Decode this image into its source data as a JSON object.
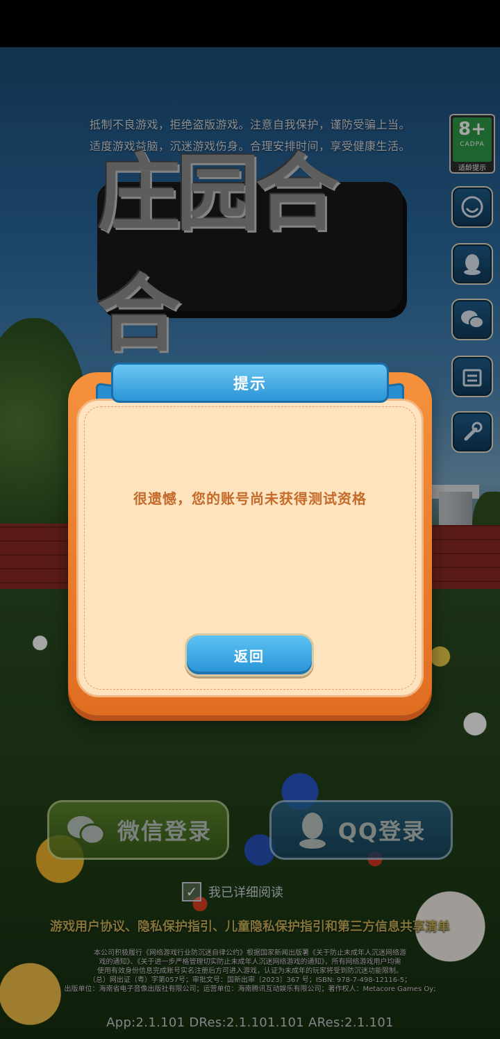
{
  "notice": {
    "line1": "抵制不良游戏，拒绝盗版游戏。注意自我保护，谨防受骗上当。",
    "line2": "适度游戏益脑，沉迷游戏伤身。合理安排时间，享受健康生活。"
  },
  "logo": {
    "text": "庄园合合"
  },
  "age_rating": {
    "value": "8+",
    "org": "CADPA",
    "label": "适龄提示"
  },
  "dialog": {
    "title": "提示",
    "message": "很遗憾，您的账号尚未获得测试资格",
    "return_label": "返回"
  },
  "login": {
    "wechat_label": "微信登录",
    "qq_label": "QQ登录"
  },
  "agreement": {
    "read_label": "我已详细阅读",
    "checked": true,
    "link_user": "游戏用户协议",
    "sep1": "、",
    "link_privacy": "隐私保护指引",
    "sep2": "、",
    "link_child": "儿童隐私保护指引",
    "sep3": "和",
    "link_third": "第三方信息共享清单"
  },
  "legal": {
    "line1": "本公司积极履行《网络游戏行业防沉迷自律公约》根据国家新闻出版署《关于防止未成年人沉迷网络游",
    "line2": "戏的通知》、《关于进一步严格管理切实防止未成年人沉迷网络游戏的通知》，所有网络游戏用户均需",
    "line3": "使用有效身份信息完成账号实名注册后方可进入游戏，认证为未成年的玩家将受到防沉迷功能限制。",
    "line4": "（总）网出证（粤）字第057号；审批文号：国新出审〔2023〕367 号；ISBN: 978-7-498-12116-5；",
    "line5": "出版单位：海南省电子音像出版社有限公司；运营单位：海南腾讯互动娱乐有限公司；著作权人：Metacore Games Oy;"
  },
  "version": "App:2.1.101 DRes:2.1.101.101 ARes:2.1.101",
  "icons": {
    "side1": "customer-service-icon",
    "side2": "qq-penguin-icon",
    "side3": "wechat-icon",
    "side4": "notice-board-icon",
    "side5": "wrench-icon"
  }
}
